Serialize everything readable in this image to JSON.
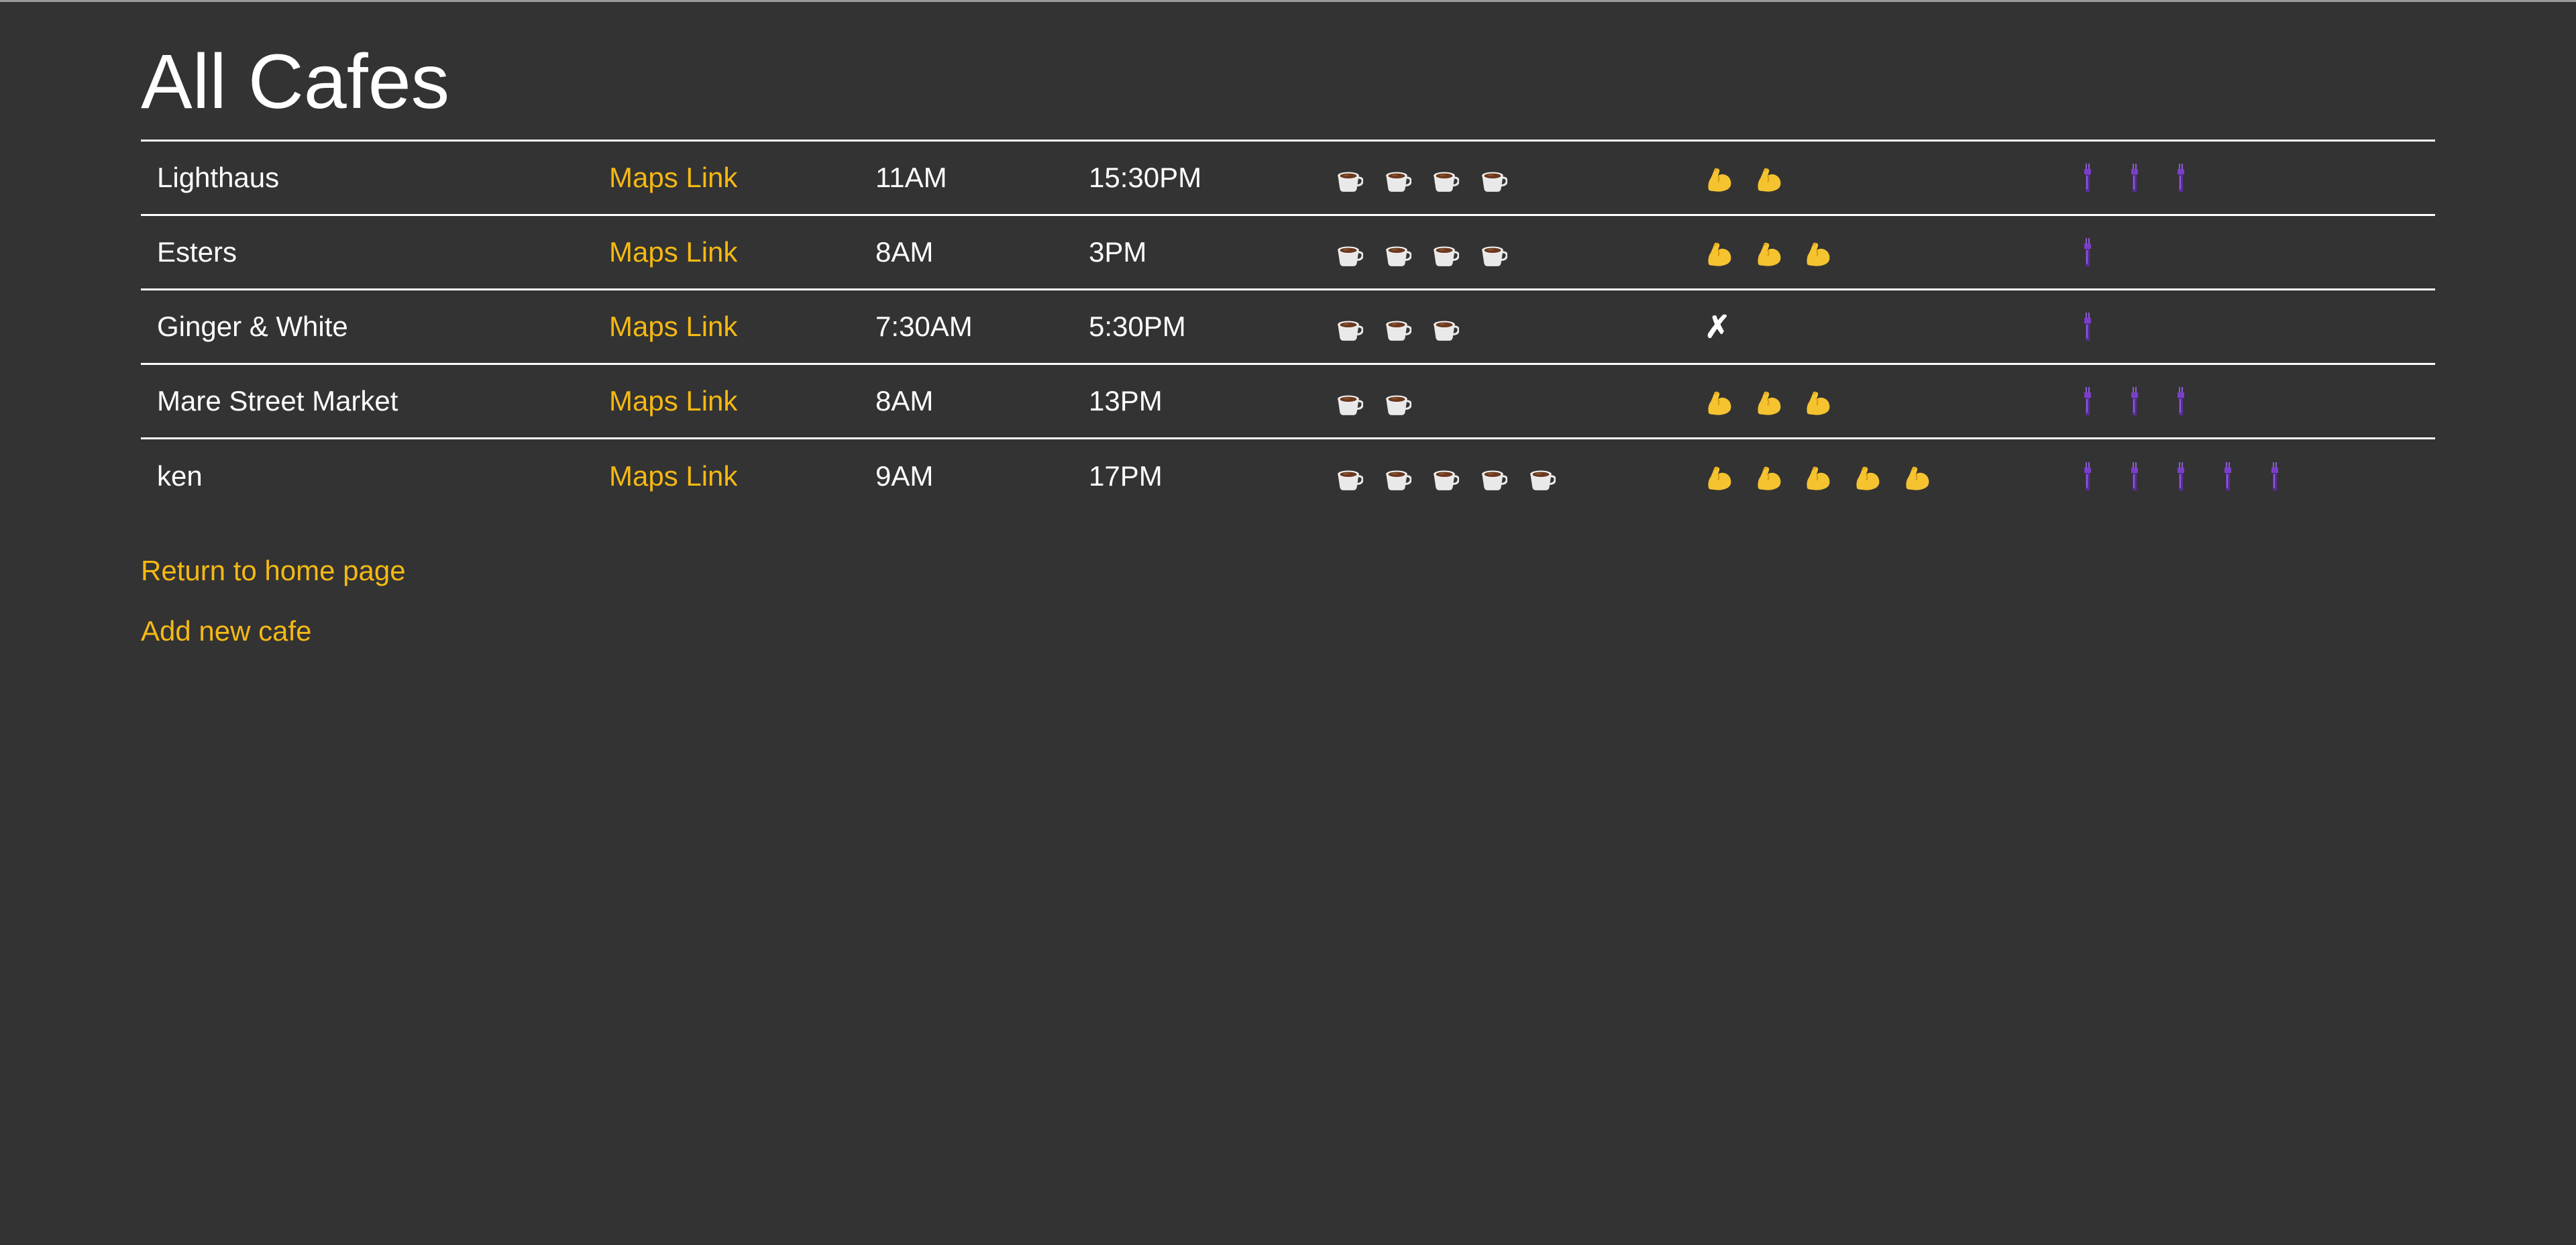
{
  "page": {
    "title": "All Cafes"
  },
  "colors": {
    "background": "#333333",
    "text": "#ffffff",
    "link": "#f5b914",
    "rule": "#ffffff"
  },
  "icons": {
    "coffee": "coffee-cup-icon",
    "strength": "flexed-biceps-icon",
    "vibe": "torch-icon",
    "none": "cross-mark-icon"
  },
  "cafes": [
    {
      "name": "Lighthaus",
      "maps_label": "Maps Link",
      "open": "11AM",
      "close": "15:30PM",
      "coffee_rating": 4,
      "strength_rating": 2,
      "vibe_rating": 3
    },
    {
      "name": "Esters",
      "maps_label": "Maps Link",
      "open": "8AM",
      "close": "3PM",
      "coffee_rating": 4,
      "strength_rating": 3,
      "vibe_rating": 1
    },
    {
      "name": "Ginger & White",
      "maps_label": "Maps Link",
      "open": "7:30AM",
      "close": "5:30PM",
      "coffee_rating": 3,
      "strength_rating": 0,
      "strength_none_glyph": "✗",
      "vibe_rating": 1
    },
    {
      "name": "Mare Street Market",
      "maps_label": "Maps Link",
      "open": "8AM",
      "close": "13PM",
      "coffee_rating": 2,
      "strength_rating": 3,
      "vibe_rating": 3
    },
    {
      "name": "ken",
      "maps_label": "Maps Link",
      "open": "9AM",
      "close": "17PM",
      "coffee_rating": 5,
      "strength_rating": 5,
      "vibe_rating": 5
    }
  ],
  "footer": {
    "home_label": "Return to home page",
    "add_label": "Add new cafe"
  }
}
